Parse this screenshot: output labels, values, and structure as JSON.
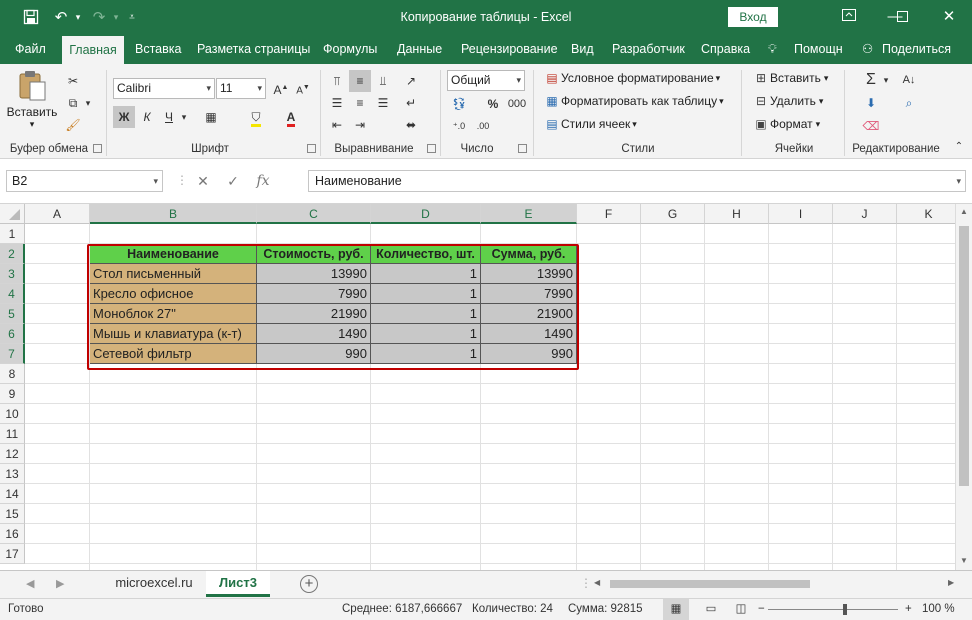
{
  "window": {
    "title": "Копирование таблицы  -  Excel",
    "signin_label": "Вход",
    "quick_access": [
      "save-icon",
      "undo-icon",
      "redo-icon",
      "customize-icon"
    ],
    "controls": [
      "ribbon-display-icon",
      "minimize-icon",
      "maximize-icon",
      "close-icon"
    ]
  },
  "ribbon_tabs": [
    {
      "label": "Файл",
      "active": false
    },
    {
      "label": "Главная",
      "active": true
    },
    {
      "label": "Вставка",
      "active": false
    },
    {
      "label": "Разметка страницы",
      "active": false
    },
    {
      "label": "Формулы",
      "active": false
    },
    {
      "label": "Данные",
      "active": false
    },
    {
      "label": "Рецензирование",
      "active": false
    },
    {
      "label": "Вид",
      "active": false
    },
    {
      "label": "Разработчик",
      "active": false
    },
    {
      "label": "Справка",
      "active": false
    },
    {
      "label": "Помощн",
      "active": false
    },
    {
      "label": "Поделиться",
      "active": false
    }
  ],
  "ribbon": {
    "clipboard": {
      "label": "Буфер обмена",
      "paste_label": "Вставить"
    },
    "font": {
      "label": "Шрифт",
      "font_name": "Calibri",
      "font_size": "11",
      "bold": "Ж",
      "italic": "К",
      "underline": "Ч"
    },
    "alignment": {
      "label": "Выравнивание"
    },
    "number": {
      "label": "Число",
      "format": "Общий"
    },
    "styles": {
      "label": "Стили",
      "conditional": "Условное форматирование",
      "as_table": "Форматировать как таблицу",
      "cell_styles": "Стили ячеек"
    },
    "cells": {
      "label": "Ячейки",
      "insert": "Вставить",
      "delete": "Удалить",
      "format": "Формат"
    },
    "editing": {
      "label": "Редактирование"
    }
  },
  "formula_bar": {
    "name_box": "B2",
    "formula": "Наименование",
    "cancel_icon": "✕",
    "enter_icon": "✓",
    "fx_label": "fx"
  },
  "columns": [
    "A",
    "B",
    "C",
    "D",
    "E",
    "F",
    "G",
    "H",
    "I",
    "J",
    "K"
  ],
  "selected_columns": [
    "B",
    "C",
    "D",
    "E"
  ],
  "rows": [
    "1",
    "2",
    "3",
    "4",
    "5",
    "6",
    "7",
    "8",
    "9",
    "10",
    "11",
    "12",
    "13",
    "14",
    "15",
    "16",
    "17"
  ],
  "selected_rows": [
    "2",
    "3",
    "4",
    "5",
    "6",
    "7"
  ],
  "table": {
    "headers": [
      "Наименование",
      "Стоимость, руб.",
      "Количество, шт.",
      "Сумма, руб."
    ],
    "rows": [
      [
        "Стол письменный",
        "13990",
        "1",
        "13990"
      ],
      [
        "Кресло офисное",
        "7990",
        "1",
        "7990"
      ],
      [
        "Моноблок 27\"",
        "21990",
        "1",
        "21900"
      ],
      [
        "Мышь и клавиатура (к-т)",
        "1490",
        "1",
        "1490"
      ],
      [
        "Сетевой фильтр",
        "990",
        "1",
        "990"
      ]
    ],
    "colors": {
      "header": "#5fd04a",
      "names": "#d4b27b",
      "numbers": "#c8c8c8",
      "selection": "#c00000"
    }
  },
  "sheets": [
    {
      "label": "microexcel.ru",
      "active": false
    },
    {
      "label": "Лист3",
      "active": true
    }
  ],
  "status": {
    "ready": "Готово",
    "average": "Среднее: 6187,666667",
    "count": "Количество: 24",
    "sum": "Сумма: 92815",
    "zoom": "100 %"
  },
  "accent": "#217346"
}
